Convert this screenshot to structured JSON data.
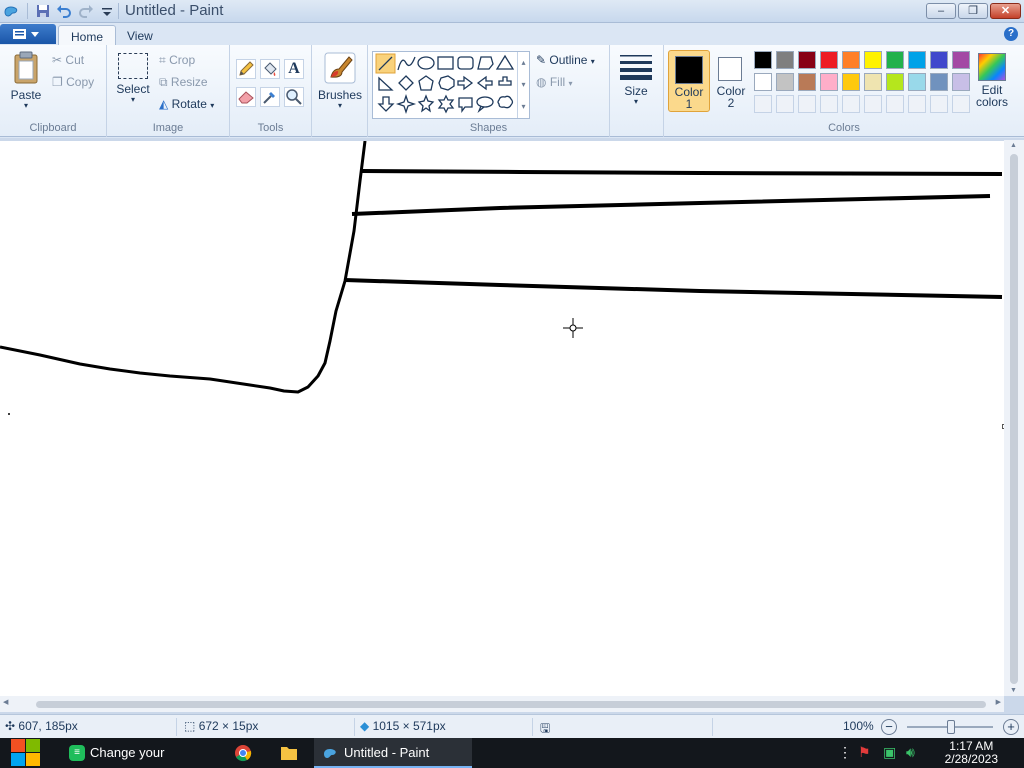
{
  "window": {
    "title": "Untitled - Paint",
    "controls": {
      "minimize": "–",
      "maximize": "❐",
      "close": "✕"
    }
  },
  "tabs": [
    {
      "label": "Home",
      "active": true
    },
    {
      "label": "View",
      "active": false
    }
  ],
  "help": "?",
  "clipboard": {
    "paste": "Paste",
    "cut": "Cut",
    "copy": "Copy",
    "label": "Clipboard"
  },
  "image": {
    "select": "Select",
    "crop": "Crop",
    "resize": "Resize",
    "rotate": "Rotate",
    "label": "Image"
  },
  "tools": {
    "label": "Tools"
  },
  "brushes": {
    "label": "Brushes"
  },
  "shapes": {
    "outline": "Outline",
    "fill": "Fill",
    "label": "Shapes"
  },
  "size": {
    "label": "Size"
  },
  "colors": {
    "color1": {
      "label1": "Color",
      "label2": "1",
      "value": "#000000"
    },
    "color2": {
      "label1": "Color",
      "label2": "2",
      "value": "#ffffff"
    },
    "edit1": "Edit",
    "edit2": "colors",
    "label": "Colors",
    "palette_row1": [
      "#000000",
      "#7f7f7f",
      "#880015",
      "#ed1c24",
      "#ff7f27",
      "#fff200",
      "#22b14c",
      "#00a2e8",
      "#3f48cc",
      "#a349a4"
    ],
    "palette_row2": [
      "#ffffff",
      "#c3c3c3",
      "#b97a57",
      "#ffaec9",
      "#ffc90e",
      "#efe4b0",
      "#b5e61d",
      "#99d9ea",
      "#7092be",
      "#c8bfe7"
    ]
  },
  "status": {
    "cursor_pos": "607, 185px",
    "selection_size": "672 × 15px",
    "image_size": "1015 × 571px",
    "zoom": "100%"
  },
  "taskbar": {
    "items": [
      {
        "label": "Change your deskto..."
      },
      {
        "label": "Untitled - Paint"
      }
    ],
    "time": "1:17 AM",
    "date": "2/28/2023"
  }
}
